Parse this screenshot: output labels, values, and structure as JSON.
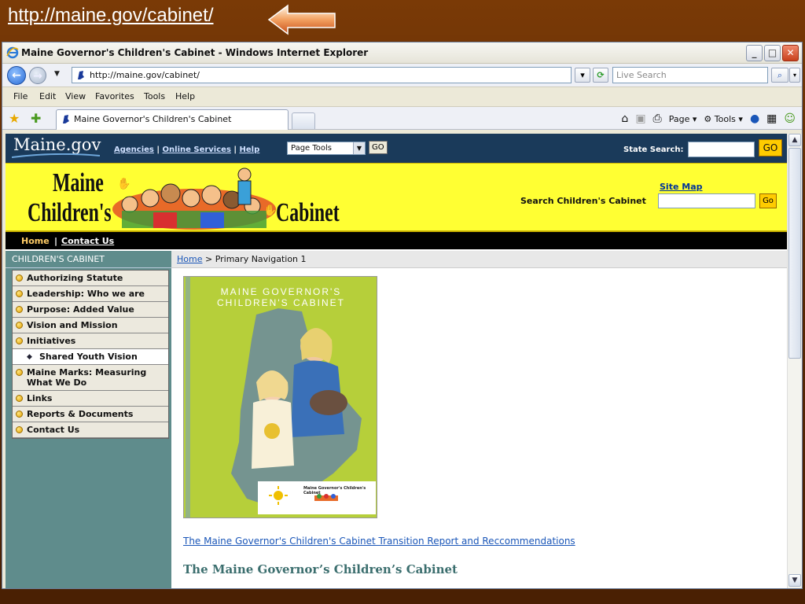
{
  "slide": {
    "url_text": "http://maine.gov/cabinet/"
  },
  "window": {
    "title": "Maine Governor's Children's Cabinet - Windows Internet Explorer",
    "address": "http://maine.gov/cabinet/",
    "search_placeholder": "Live Search",
    "tab_label": "Maine Governor's Children's Cabinet",
    "menu": [
      {
        "label": "File",
        "key": "F"
      },
      {
        "label": "Edit",
        "key": "E"
      },
      {
        "label": "View",
        "key": "V"
      },
      {
        "label": "Favorites",
        "key": "a"
      },
      {
        "label": "Tools",
        "key": "T"
      },
      {
        "label": "Help",
        "key": "H"
      }
    ],
    "commands": {
      "page": "Page",
      "tools": "Tools"
    }
  },
  "site": {
    "logo": "Maine.gov",
    "links": [
      "Agencies",
      "Online Services",
      "Help"
    ],
    "page_tools_value": "Page Tools",
    "page_tools_go": "GO",
    "state_search_label": "State Search:",
    "state_search_go": "GO",
    "banner": {
      "title_line1": "Maine",
      "title_line2": "Children's",
      "title_line3": "Cabinet"
    },
    "site_map": "Site Map",
    "child_search_label": "Search Children's Cabinet",
    "child_search_go": "Go",
    "home": "Home",
    "contact": "Contact Us"
  },
  "nav": {
    "title": "CHILDREN'S CABINET",
    "items": [
      {
        "label": "Authorizing Statute"
      },
      {
        "label": "Leadership: Who we are"
      },
      {
        "label": "Purpose: Added Value"
      },
      {
        "label": "Vision and Mission"
      },
      {
        "label": "Initiatives"
      },
      {
        "label": "Shared Youth Vision",
        "sub": true
      },
      {
        "label": "Maine Marks: Measuring What We Do"
      },
      {
        "label": "Links"
      },
      {
        "label": "Reports & Documents"
      },
      {
        "label": "Contact Us"
      }
    ]
  },
  "main": {
    "crumb_home": "Home",
    "crumb_rest": " > Primary Navigation 1",
    "cover_line1": "MAINE GOVERNOR'S",
    "cover_line2": "CHILDREN'S CABINET",
    "cover_footer_title": "Maine Governor's Children's Cabinet",
    "report_link": "The Maine Governor's Children's Cabinet Transition Report and Reccommendations",
    "heading": "The Maine Governor’s Children’s Cabinet"
  },
  "colors": {
    "slide_bg": "#5a2804",
    "maine_header": "#1a3a5a",
    "banner_yellow": "#ffff33",
    "leftnav_teal": "#5f8c8c",
    "go_gold": "#ffcc00",
    "heading_teal": "#3b6e6e"
  }
}
